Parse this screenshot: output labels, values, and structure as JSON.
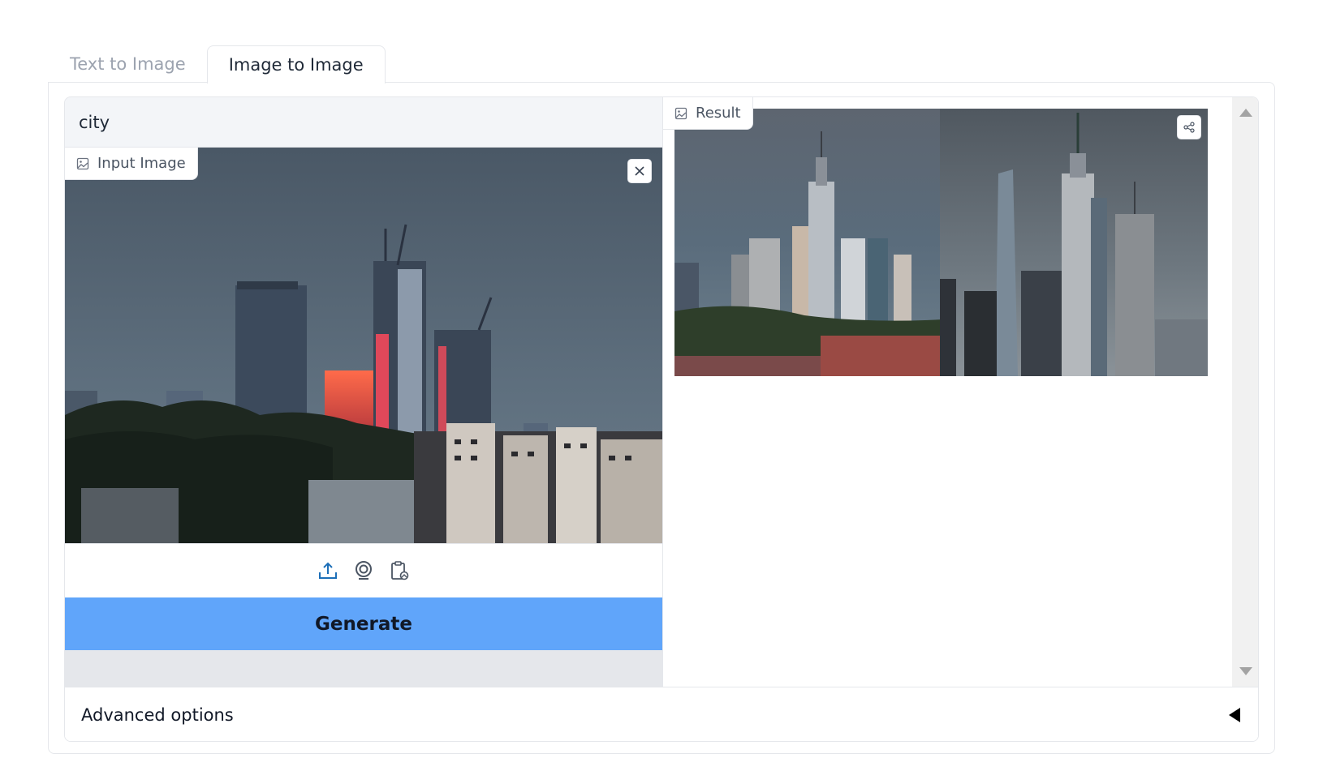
{
  "tabs": [
    {
      "label": "Text to Image",
      "active": false
    },
    {
      "label": "Image to Image",
      "active": true
    }
  ],
  "prompt": {
    "value": "city"
  },
  "input_image": {
    "label": "Input Image",
    "label_icon": "image-icon",
    "close_icon": "close-icon",
    "source_icons": [
      "upload-icon",
      "webcam-icon",
      "clipboard-icon"
    ]
  },
  "generate": {
    "label": "Generate"
  },
  "result": {
    "label": "Result",
    "label_icon": "image-icon",
    "share_icon": "share-icon",
    "image_count": 2
  },
  "advanced": {
    "label": "Advanced options",
    "caret_icon": "caret-left-icon"
  },
  "colors": {
    "accent": "#60a5fa",
    "border": "#e5e7eb",
    "prompt_bg": "#f3f5f8",
    "icon_blue": "#1d6fb8"
  }
}
